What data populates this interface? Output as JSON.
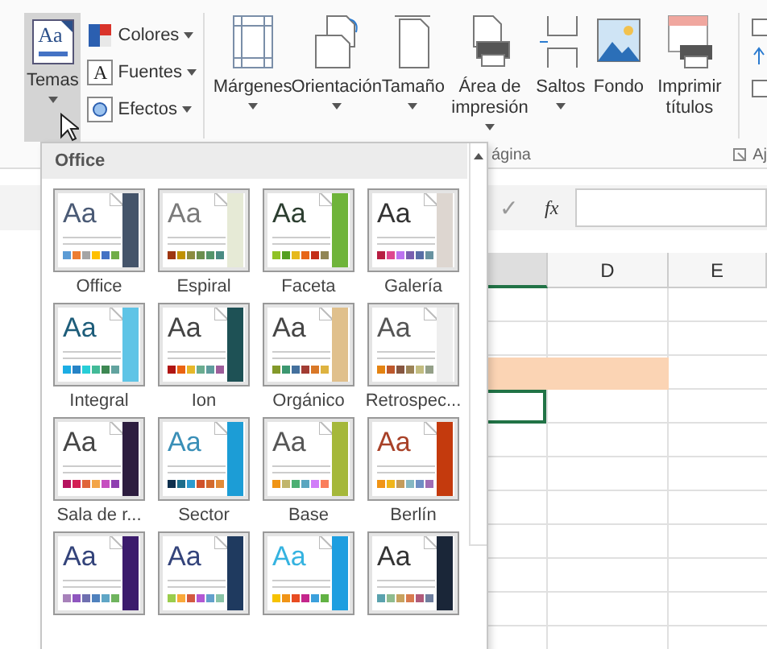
{
  "ribbon": {
    "themes_button": {
      "label": "Temas",
      "icon_text": "Aa",
      "selected": true
    },
    "small_buttons": [
      {
        "label": "Colores",
        "kind": "colors"
      },
      {
        "label": "Fuentes",
        "kind": "fonts",
        "icon_text": "A"
      },
      {
        "label": "Efectos",
        "kind": "effects"
      }
    ],
    "buttons": [
      {
        "label": "Márgenes",
        "kind": "margins",
        "dropdown": true
      },
      {
        "label": "Orientación",
        "kind": "orientation",
        "dropdown": true
      },
      {
        "label": "Tamaño",
        "kind": "size",
        "dropdown": true
      },
      {
        "label": "Área de impresión",
        "kind": "print-area",
        "dropdown": true
      },
      {
        "label": "Saltos",
        "kind": "breaks",
        "dropdown": true
      },
      {
        "label": "Fondo",
        "kind": "background",
        "dropdown": false
      },
      {
        "label": "Imprimir títulos",
        "kind": "print-titles",
        "dropdown": false
      }
    ],
    "group_label": "ágina",
    "next_group_label": "Aj"
  },
  "formula_bar": {
    "enter_symbol": "✓",
    "function_symbol": "fx"
  },
  "themes_panel": {
    "header": "Office",
    "themes": [
      {
        "name": "Office",
        "sample": {
          "text": "Aa",
          "color": "#4a5a75"
        },
        "color": "#44546a",
        "swatches": [
          {
            "color": "#5b9bd5"
          },
          {
            "color": "#ed7d31"
          },
          {
            "color": "#a5a5a5"
          },
          {
            "color": "#ffc000"
          },
          {
            "color": "#4472c4"
          },
          {
            "color": "#70ad47"
          }
        ]
      },
      {
        "name": "Espiral",
        "sample": {
          "text": "Aa",
          "color": "#7a7a7a"
        },
        "color": "#e6ead6",
        "swatches": [
          {
            "color": "#9e3611"
          },
          {
            "color": "#c09100"
          },
          {
            "color": "#8c8c40"
          },
          {
            "color": "#6b8e4e"
          },
          {
            "color": "#54946a"
          },
          {
            "color": "#4a8b83"
          }
        ]
      },
      {
        "name": "Faceta",
        "sample": {
          "text": "Aa",
          "color": "#2c3e30"
        },
        "color": "#6fb43a",
        "swatches": [
          {
            "color": "#90c226"
          },
          {
            "color": "#54a021"
          },
          {
            "color": "#e6b91e"
          },
          {
            "color": "#e76618"
          },
          {
            "color": "#c42f1a"
          },
          {
            "color": "#918655"
          }
        ]
      },
      {
        "name": "Galería",
        "sample": {
          "text": "Aa",
          "color": "#333333"
        },
        "color": "#ddd6d0",
        "swatches": [
          {
            "color": "#b71e42"
          },
          {
            "color": "#de478e"
          },
          {
            "color": "#bc72f0"
          },
          {
            "color": "#795faf"
          },
          {
            "color": "#586ea6"
          },
          {
            "color": "#6892a0"
          }
        ]
      },
      {
        "name": "Integral",
        "sample": {
          "text": "Aa",
          "color": "#1e5d7a"
        },
        "color": "#5fc4e6",
        "swatches": [
          {
            "color": "#1cade4"
          },
          {
            "color": "#2683c6"
          },
          {
            "color": "#27ced7"
          },
          {
            "color": "#42ba97"
          },
          {
            "color": "#3e8853"
          },
          {
            "color": "#62a39f"
          }
        ]
      },
      {
        "name": "Ion",
        "sample": {
          "text": "Aa",
          "color": "#444444"
        },
        "color": "#1e5155",
        "swatches": [
          {
            "color": "#b01513"
          },
          {
            "color": "#ea6312"
          },
          {
            "color": "#e6b729"
          },
          {
            "color": "#6aac90"
          },
          {
            "color": "#5f9c9d"
          },
          {
            "color": "#9e5e9b"
          }
        ]
      },
      {
        "name": "Orgánico",
        "sample": {
          "text": "Aa",
          "color": "#454545"
        },
        "color": "#e0c08c",
        "swatches": [
          {
            "color": "#83992a"
          },
          {
            "color": "#3c9770"
          },
          {
            "color": "#44709d"
          },
          {
            "color": "#a23c33"
          },
          {
            "color": "#d97828"
          },
          {
            "color": "#deb340"
          }
        ]
      },
      {
        "name": "Retrospec...",
        "sample": {
          "text": "Aa",
          "color": "#555555"
        },
        "color": "#eeeeee",
        "swatches": [
          {
            "color": "#e48312"
          },
          {
            "color": "#bd582c"
          },
          {
            "color": "#865640"
          },
          {
            "color": "#9b8357"
          },
          {
            "color": "#c2bc80"
          },
          {
            "color": "#94a088"
          }
        ]
      },
      {
        "name": "Sala de r...",
        "sample": {
          "text": "Aa",
          "color": "#464646"
        },
        "color": "#2d1d3f",
        "swatches": [
          {
            "color": "#b5125e"
          },
          {
            "color": "#d31e54"
          },
          {
            "color": "#e0653b"
          },
          {
            "color": "#f3a447"
          },
          {
            "color": "#c64fc0"
          },
          {
            "color": "#8e3fb0"
          }
        ]
      },
      {
        "name": "Sector",
        "sample": {
          "text": "Aa",
          "color": "#3a8fb7"
        },
        "color": "#1c9dd6",
        "swatches": [
          {
            "color": "#0e2f4d"
          },
          {
            "color": "#1c6d8b"
          },
          {
            "color": "#2b9bd0"
          },
          {
            "color": "#d0522b"
          },
          {
            "color": "#d36a2d"
          },
          {
            "color": "#e28b38"
          }
        ]
      },
      {
        "name": "Base",
        "sample": {
          "text": "Aa",
          "color": "#565656"
        },
        "color": "#a5b83a",
        "swatches": [
          {
            "color": "#f09415"
          },
          {
            "color": "#c1b56b"
          },
          {
            "color": "#4baf73"
          },
          {
            "color": "#5aa6c0"
          },
          {
            "color": "#d17df9"
          },
          {
            "color": "#fa7e5c"
          }
        ]
      },
      {
        "name": "Berlín",
        "sample": {
          "text": "Aa",
          "color": "#a84128"
        },
        "color": "#c43a0d",
        "swatches": [
          {
            "color": "#f09416"
          },
          {
            "color": "#f0b51a"
          },
          {
            "color": "#c49c5b"
          },
          {
            "color": "#85b7c2"
          },
          {
            "color": "#6f8ec4"
          },
          {
            "color": "#a06db4"
          }
        ]
      },
      {
        "sample": {
          "text": "Aa",
          "color": "#33437a"
        },
        "color": "#3b1b6c",
        "swatches": [
          {
            "color": "#a781ba"
          },
          {
            "color": "#8f56bf"
          },
          {
            "color": "#6f6fb0"
          },
          {
            "color": "#4f81bd"
          },
          {
            "color": "#5fa6c6"
          },
          {
            "color": "#6fb45e"
          }
        ]
      },
      {
        "sample": {
          "text": "Aa",
          "color": "#34447b"
        },
        "color": "#1f3a5f",
        "swatches": [
          {
            "color": "#9acd4c"
          },
          {
            "color": "#faa93a"
          },
          {
            "color": "#d35940"
          },
          {
            "color": "#b258d3"
          },
          {
            "color": "#63a0cc"
          },
          {
            "color": "#8ac4a7"
          }
        ]
      },
      {
        "sample": {
          "text": "Aa",
          "color": "#35b3e0"
        },
        "color": "#1e9ee0",
        "swatches": [
          {
            "color": "#f6c200"
          },
          {
            "color": "#f09417"
          },
          {
            "color": "#e84c22"
          },
          {
            "color": "#c4268c"
          },
          {
            "color": "#3ba0dc"
          },
          {
            "color": "#62b244"
          }
        ]
      },
      {
        "sample": {
          "text": "Aa",
          "color": "#343434"
        },
        "color": "#1a2638",
        "swatches": [
          {
            "color": "#5aa2ae"
          },
          {
            "color": "#8fbc8f"
          },
          {
            "color": "#c8a25f"
          },
          {
            "color": "#d87b4f"
          },
          {
            "color": "#b05a7a"
          },
          {
            "color": "#6f7f9f"
          }
        ]
      }
    ]
  },
  "sheet": {
    "columns": [
      {
        "selected": true
      },
      {
        "label": "D",
        "selected": false
      },
      {
        "label": "E",
        "selected": false
      }
    ]
  }
}
